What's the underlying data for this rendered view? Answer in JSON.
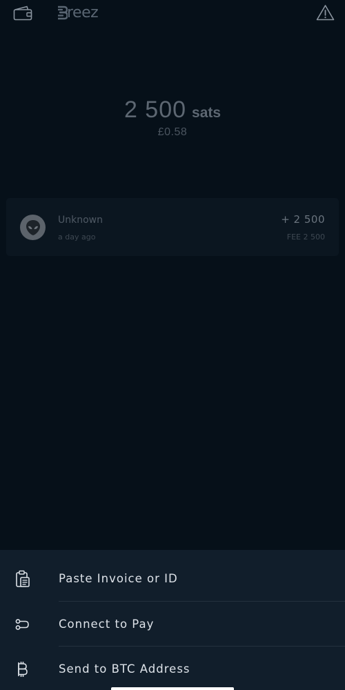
{
  "app": {
    "logo_text": "reez"
  },
  "balance": {
    "amount": "2 500",
    "unit": "sats",
    "fiat": "£0.58"
  },
  "transactions": [
    {
      "title": "Unknown",
      "time": "a day ago",
      "amount": "+ 2 500",
      "fee": "FEE 2 500",
      "icon": "alien-avatar-icon"
    }
  ],
  "actions": [
    {
      "label": "Paste Invoice or ID",
      "icon": "clipboard-icon"
    },
    {
      "label": "Connect to Pay",
      "icon": "connect-icon"
    },
    {
      "label": "Send to BTC Address",
      "icon": "bitcoin-icon"
    }
  ],
  "colors": {
    "background": "#061019",
    "sheet": "#111e2b",
    "card": "#0b1620",
    "text_primary": "#dde2e8",
    "text_muted": "#5d6772"
  }
}
